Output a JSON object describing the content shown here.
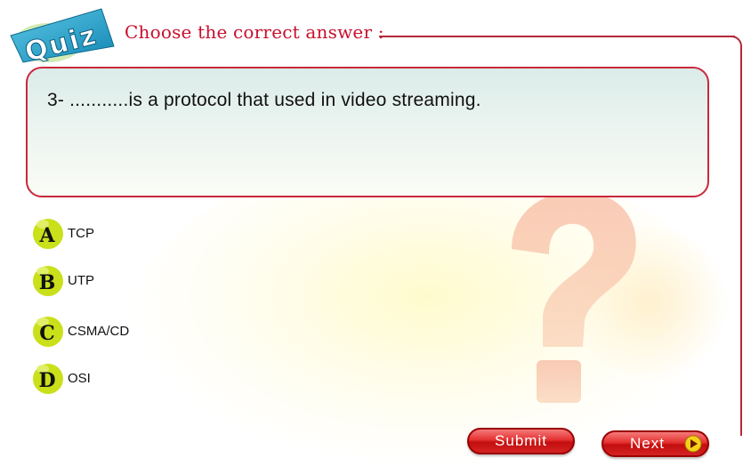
{
  "header": {
    "badge_label": "Quiz",
    "instruction": "Choose the correct answer :"
  },
  "question": {
    "text": "3- ...........is a protocol that used in video streaming."
  },
  "options": [
    {
      "letter": "A",
      "label": "TCP"
    },
    {
      "letter": "B",
      "label": "UTP"
    },
    {
      "letter": "C",
      "label": "CSMA/CD"
    },
    {
      "letter": "D",
      "label": "OSI"
    }
  ],
  "buttons": {
    "submit": "Submit",
    "next": "Next"
  },
  "colors": {
    "accent_red": "#c8102e",
    "option_ball": "#c9e01a",
    "badge_blue": "#1f9fc4",
    "qmark_orange": "#f6c9a8"
  },
  "icons": {
    "option_marker": "letter-ball-icon",
    "decor": "question-mark-icon",
    "next": "play-icon"
  }
}
